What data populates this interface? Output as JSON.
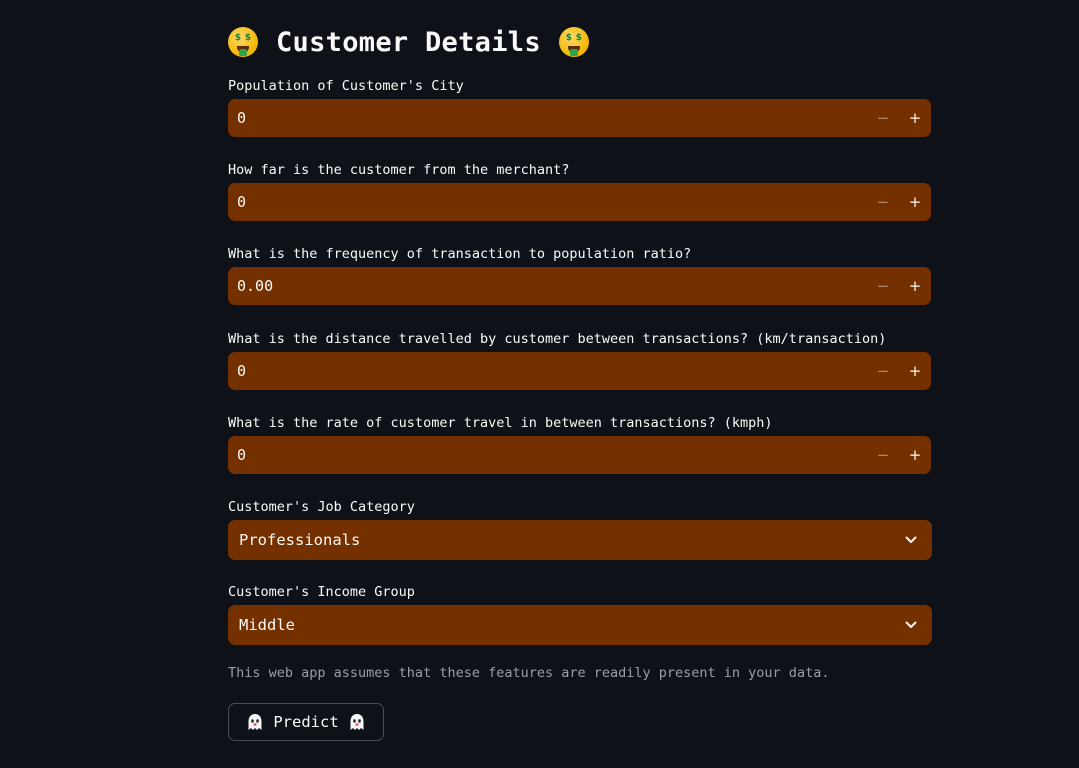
{
  "header": {
    "title": "Customer Details",
    "emoji": "money-mouth-face"
  },
  "fields": [
    {
      "label": "Population of Customer's City",
      "value": "0"
    },
    {
      "label": "How far is the customer from the merchant?",
      "value": "0"
    },
    {
      "label": "What is the frequency of transaction to population ratio?",
      "value": "0.00"
    },
    {
      "label": "What is the distance travelled by customer between transactions? (km/transaction)",
      "value": "0"
    },
    {
      "label": "What is the rate of customer travel in between transactions? (kmph)",
      "value": "0"
    }
  ],
  "stepper": {
    "minus": "−",
    "plus": "+"
  },
  "selects": [
    {
      "label": "Customer's Job Category",
      "value": "Professionals"
    },
    {
      "label": "Customer's Income Group",
      "value": "Middle"
    }
  ],
  "caption": "This web app assumes that these features are readily present in your data.",
  "predict_button": {
    "label": "Predict",
    "icon": "ghost"
  },
  "colors": {
    "background": "#0e1117",
    "input_bg": "#753000",
    "text": "#fafafa",
    "caption": "#9b9ea6"
  }
}
